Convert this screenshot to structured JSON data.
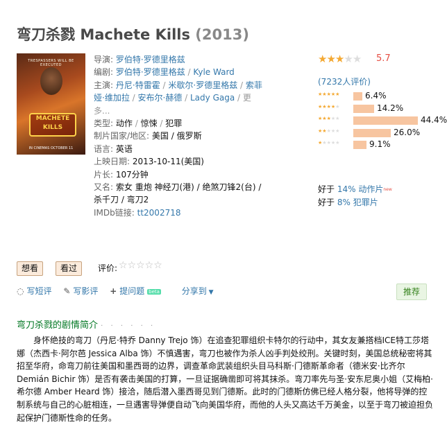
{
  "title": {
    "cn": "弯刀杀戮",
    "en": "Machete Kills",
    "year": "(2013)"
  },
  "poster": {
    "top_text": "TRESPASSERS WILL BE EXECUTED",
    "logo_line1": "MACHETE",
    "logo_line2": "KILLS",
    "release_text": "IN CINEMAS OCTOBER 11"
  },
  "info": {
    "director_label": "导演:",
    "director": "罗伯特·罗德里格兹",
    "writer_label": "编剧:",
    "writers": [
      "罗伯特·罗德里格兹",
      "Kyle Ward"
    ],
    "cast_label": "主演:",
    "cast": [
      "丹尼·特雷霍",
      "米歇尔·罗德里格兹",
      "索菲娅·维加拉",
      "安布尔·赫德",
      "Lady Gaga"
    ],
    "more": "更多...",
    "genre_label": "类型:",
    "genres": [
      "动作",
      "惊悚",
      "犯罪"
    ],
    "country_label": "制片国家/地区:",
    "country": "美国 / 俄罗斯",
    "language_label": "语言:",
    "language": "英语",
    "release_label": "上映日期:",
    "release": "2013-10-11(美国)",
    "runtime_label": "片长:",
    "runtime": "107分钟",
    "aka_label": "又名:",
    "aka": "索女 重炮 神经刀(港) / 绝煞刀锋2(台) / 杀千刀 / 弯刀2",
    "imdb_label": "IMDb链接:",
    "imdb": "tt2002718"
  },
  "rating": {
    "score": "5.7",
    "stars": 3,
    "votes": "(7232人评价)",
    "distribution": [
      {
        "stars": 5,
        "percent": 6.4,
        "label": "6.4%"
      },
      {
        "stars": 4,
        "percent": 14.2,
        "label": "14.2%"
      },
      {
        "stars": 3,
        "percent": 44.4,
        "label": "44.4%"
      },
      {
        "stars": 2,
        "percent": 26.0,
        "label": "26.0%"
      },
      {
        "stars": 1,
        "percent": 9.1,
        "label": "9.1%"
      }
    ]
  },
  "better_than": [
    {
      "prefix": "好于 ",
      "pct": "14%",
      "genre": "动作片",
      "badge": "new"
    },
    {
      "prefix": "好于 ",
      "pct": "8%",
      "genre": "犯罪片",
      "badge": ""
    }
  ],
  "buttons": {
    "want": "想看",
    "seen": "看过",
    "rate_label": "评价:",
    "rate_stars": "☆☆☆☆☆"
  },
  "actions": {
    "short_review": "写短评",
    "review": "写影评",
    "ask": "提问题",
    "beta": "beta",
    "share": "分享到",
    "recommend": "推荐"
  },
  "synopsis": {
    "title": "弯刀杀戮的剧情简介",
    "dots": "· · · · · ·",
    "text": "身怀绝技的弯刀（丹尼·特乔 Danny Trejo 饰）在追查犯罪组织卡特尔的行动中，其女友兼搭档ICE特工莎塔娜（杰西卡·阿尔芭 Jessica Alba 饰）不慎遇害，弯刀也被作为杀人凶手判处绞刑。关键时刻，美国总统秘密将其招至华府，命弯刀前往美国和墨西哥的边界，调查革命武装组织头目马科斯·门德斯革命者（德米安·比齐尔 Demián Bichir 饰）是否有袭击美国的打算，一旦证据确凿即可将其抹杀。弯刀率先与圣·安东尼奥小姐（艾梅柏·希尔德 Amber Heard 饰）接洽，随后潜入墨西哥见到门德斯。此时的门德斯仿佛已经人格分裂，他将导弹的控制系统与自己的心脏相连，一旦遇害导弹便自动飞向美国华府，而他的人头又高达千万美金，以至于弯刀被迫担负起保护门德斯性命的任务。"
  }
}
